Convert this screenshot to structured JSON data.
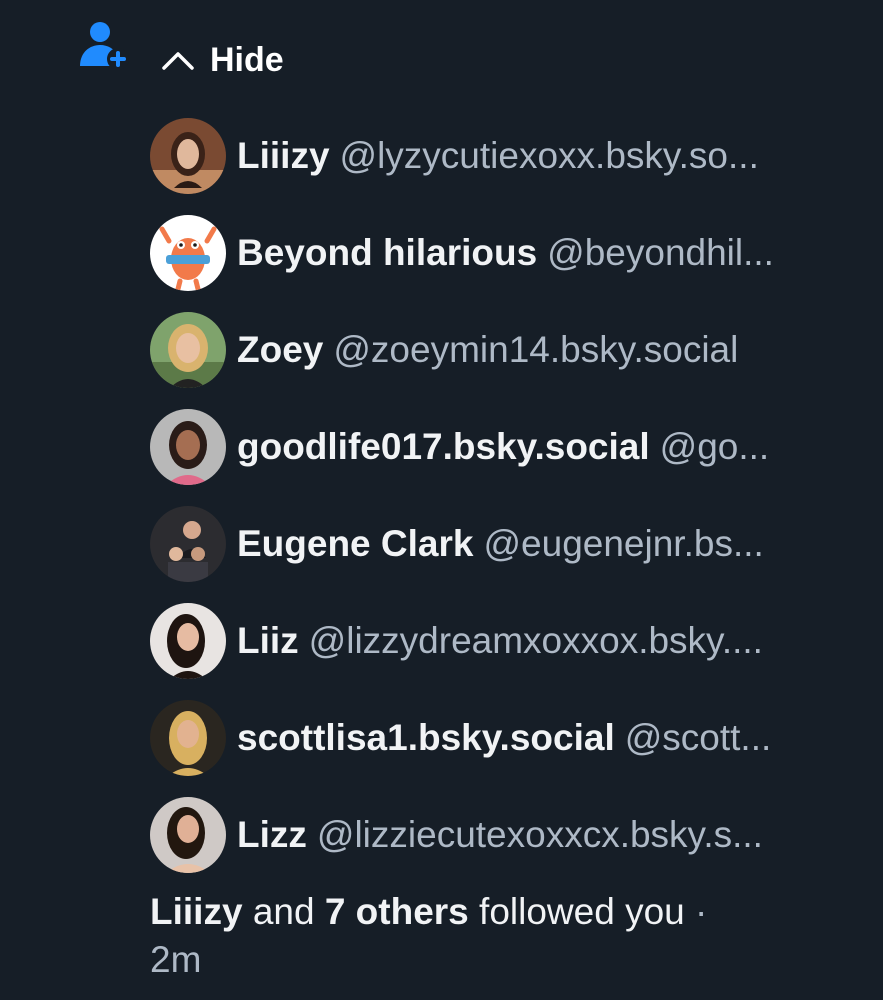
{
  "header": {
    "icon": "person-add-icon",
    "accent_color": "#208bfe",
    "toggle_label": "Hide",
    "toggle_icon": "chevron-up-icon"
  },
  "followers": [
    {
      "name": "Liiizy",
      "handle": "@lyzycutiexoxx.bsky.so..."
    },
    {
      "name": "Beyond hilarious",
      "handle": "@beyondhil..."
    },
    {
      "name": "Zoey",
      "handle": "@zoeymin14.bsky.social"
    },
    {
      "name": "goodlife017.bsky.social",
      "handle": "@go..."
    },
    {
      "name": "Eugene Clark",
      "handle": "@eugenejnr.bs..."
    },
    {
      "name": "Liiz",
      "handle": "@lizzydreamxoxxox.bsky...."
    },
    {
      "name": "scottlisa1.bsky.social",
      "handle": "@scott..."
    },
    {
      "name": "Lizz",
      "handle": "@lizziecutexoxxcx.bsky.s..."
    }
  ],
  "summary": {
    "first_name": "Liiizy",
    "conj": "and",
    "others": "7 others",
    "action": "followed you",
    "sep": "·",
    "time": "2m"
  }
}
